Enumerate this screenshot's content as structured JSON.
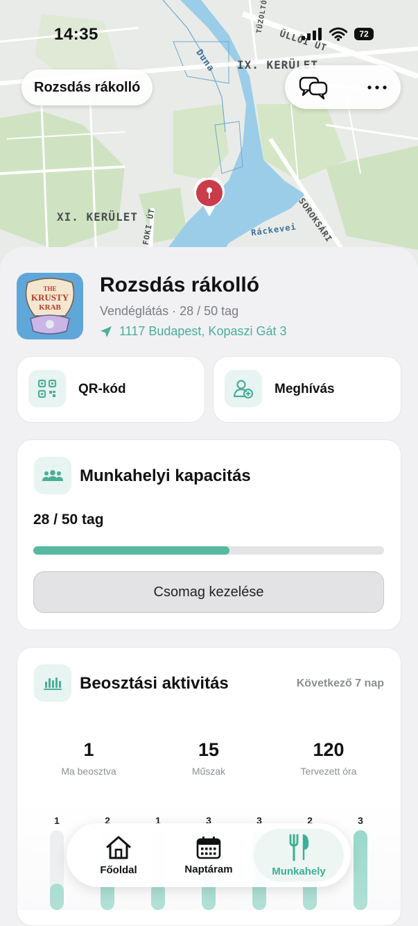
{
  "status_bar": {
    "time": "14:35",
    "battery": "72"
  },
  "map": {
    "labels": {
      "district_ix": "IX. KERÜLET",
      "district_xi": "XI. KERÜLET",
      "ulloi": "ÜLLŐI ÚT",
      "duna": "Duna",
      "rackevei": "Ráckevei",
      "soroksari": "SOROKSÁRI",
      "fokuti": "FOKI ÚT",
      "street_top": "TŰZOLTÓ U."
    }
  },
  "header": {
    "title": "Rozsdás rákolló"
  },
  "workplace": {
    "name": "Rozsdás rákolló",
    "category": "Vendéglátás · 28 / 50 tag",
    "address": "1117 Budapest, Kopaszi Gát 3",
    "logo_text_1": "THE",
    "logo_text_2": "KRUSTY",
    "logo_text_3": "KRAB"
  },
  "quick_actions": {
    "qr": "QR-kód",
    "invite": "Meghívás"
  },
  "capacity": {
    "title": "Munkahelyi kapacitás",
    "count": "28 / 50 tag",
    "progress": 0.56,
    "button": "Csomag kezelése"
  },
  "activity": {
    "title": "Beosztási aktivitás",
    "range": "Következő 7 nap",
    "stats": [
      {
        "value": "1",
        "label": "Ma beosztva"
      },
      {
        "value": "15",
        "label": "Műszak"
      },
      {
        "value": "120",
        "label": "Tervezett óra"
      }
    ],
    "bars": [
      {
        "value": "1",
        "level": 0.33
      },
      {
        "value": "2",
        "level": 0.66
      },
      {
        "value": "1",
        "level": 0.33
      },
      {
        "value": "3",
        "level": 1.0
      },
      {
        "value": "3",
        "level": 1.0
      },
      {
        "value": "2",
        "level": 0.66
      },
      {
        "value": "3",
        "level": 1.0
      }
    ]
  },
  "tabbar": {
    "home": "Főoldal",
    "calendar": "Naptáram",
    "workplace": "Munkahely"
  },
  "colors": {
    "accent": "#55b9a0",
    "accent_light": "#e7f4f1",
    "pin": "#c93c4a"
  }
}
